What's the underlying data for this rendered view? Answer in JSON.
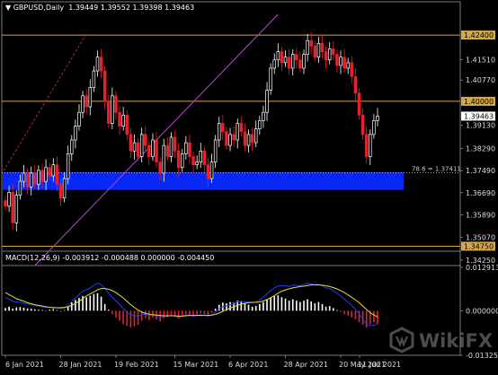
{
  "header": {
    "symbol": "GBPUSD,Daily",
    "open": "1.39449",
    "high": "1.39552",
    "low": "1.39398",
    "close": "1.39463"
  },
  "macd": {
    "label": "MACD(12,26,9)",
    "values": [
      "-0.003912",
      "-0.000488",
      "0.000000",
      "-0.004450"
    ],
    "axis_labels": [
      "0.012913",
      "0.000000",
      "-0.013251"
    ]
  },
  "price_axis": {
    "labels": [
      "1.41510",
      "1.40770",
      "1.39463",
      "1.39130",
      "1.38290",
      "1.37490",
      "1.36690",
      "1.35890",
      "1.35070",
      "1.34250"
    ],
    "highlighted": [
      "1.42400",
      "1.40000",
      "1.34750"
    ],
    "current": "1.39463"
  },
  "fib_label": "78.6 = 1.37411",
  "date_axis": [
    "6 Jan 2021",
    "28 Jan 2021",
    "19 Feb 2021",
    "15 Mar 2021",
    "6 Apr 2021",
    "28 Apr 2021",
    "20 May 2021",
    "11 Jun 2021"
  ],
  "watermark": "WikiFX",
  "colors": {
    "background": "#000000",
    "bull_candle": "#ffffff",
    "bear_candle": "#e8202a",
    "level_line": "#d4a84a",
    "zone": "#0a28f5",
    "trendline": "#b04cc8",
    "macd_hist_pos": "#ffffff",
    "macd_hist_neg": "#e8202a",
    "macd_line": "#1e3cff",
    "signal_line": "#e6dc3c"
  },
  "chart_data": {
    "type": "candlestick",
    "title": "GBPUSD,Daily",
    "ylim": [
      1.3405,
      1.4315
    ],
    "levels": [
      1.424,
      1.4,
      1.3475
    ],
    "zone": [
      1.3679,
      1.3743
    ],
    "fib_level": 1.37411,
    "close_series": [
      1.362,
      1.367,
      1.356,
      1.366,
      1.371,
      1.374,
      1.369,
      1.374,
      1.37,
      1.375,
      1.371,
      1.376,
      1.373,
      1.377,
      1.37,
      1.365,
      1.372,
      1.381,
      1.386,
      1.391,
      1.396,
      1.402,
      1.398,
      1.405,
      1.411,
      1.416,
      1.411,
      1.4,
      1.392,
      1.402,
      1.396,
      1.391,
      1.395,
      1.388,
      1.382,
      1.385,
      1.38,
      1.388,
      1.384,
      1.38,
      1.386,
      1.378,
      1.374,
      1.384,
      1.38,
      1.387,
      1.382,
      1.376,
      1.381,
      1.385,
      1.38,
      1.377,
      1.378,
      1.382,
      1.377,
      1.372,
      1.378,
      1.386,
      1.392,
      1.389,
      1.384,
      1.388,
      1.386,
      1.392,
      1.389,
      1.384,
      1.388,
      1.385,
      1.39,
      1.393,
      1.396,
      1.404,
      1.412,
      1.415,
      1.418,
      1.414,
      1.416,
      1.412,
      1.417,
      1.415,
      1.412,
      1.417,
      1.422,
      1.42,
      1.416,
      1.421,
      1.418,
      1.415,
      1.419,
      1.417,
      1.413,
      1.416,
      1.412,
      1.414,
      1.409,
      1.403,
      1.395,
      1.388,
      1.38,
      1.388,
      1.393,
      1.3946
    ],
    "macd_histogram": [
      0.0008,
      0.0012,
      0.0006,
      0.001,
      0.0011,
      0.0009,
      0.0007,
      0.0006,
      0.0004,
      0.0003,
      0.0002,
      0.0001,
      0.0003,
      0.0005,
      0.0002,
      -0.0004,
      0.0002,
      0.0012,
      0.0025,
      0.0032,
      0.0038,
      0.0044,
      0.004,
      0.0045,
      0.005,
      0.0052,
      0.0042,
      0.002,
      0.0003,
      -0.001,
      -0.002,
      -0.003,
      -0.004,
      -0.0045,
      -0.005,
      -0.0046,
      -0.0042,
      -0.003,
      -0.0022,
      -0.0028,
      -0.002,
      -0.0026,
      -0.0032,
      -0.0022,
      -0.002,
      -0.0016,
      -0.0018,
      -0.0024,
      -0.0016,
      -0.001,
      -0.0014,
      -0.0016,
      -0.0012,
      -0.0008,
      -0.001,
      -0.0014,
      -0.0006,
      0.0006,
      0.0018,
      0.0024,
      0.0022,
      0.0026,
      0.0024,
      0.003,
      0.0028,
      0.0022,
      0.0018,
      0.0012,
      0.0014,
      0.002,
      0.0026,
      0.0034,
      0.004,
      0.0044,
      0.0046,
      0.004,
      0.0036,
      0.003,
      0.0034,
      0.003,
      0.0026,
      0.003,
      0.0034,
      0.0028,
      0.0022,
      0.0026,
      0.002,
      0.0012,
      0.0014,
      0.0008,
      0.0002,
      -0.0004,
      -0.001,
      -0.0014,
      -0.002,
      -0.0026,
      -0.0034,
      -0.0042,
      -0.005,
      -0.004,
      -0.0034,
      -0.0039
    ],
    "macd_line": [
      0.004,
      0.0034,
      0.0028,
      0.0026,
      0.0025,
      0.0022,
      0.002,
      0.0018,
      0.0016,
      0.0014,
      0.0012,
      0.001,
      0.001,
      0.0011,
      0.0009,
      0.0006,
      0.0008,
      0.0016,
      0.0028,
      0.0038,
      0.0048,
      0.0058,
      0.0062,
      0.0068,
      0.0076,
      0.0082,
      0.0078,
      0.0066,
      0.0052,
      0.004,
      0.003,
      0.0018,
      0.0006,
      -0.0004,
      -0.0012,
      -0.0014,
      -0.0016,
      -0.0012,
      -0.001,
      -0.0014,
      -0.0012,
      -0.0016,
      -0.002,
      -0.0016,
      -0.0016,
      -0.0014,
      -0.0016,
      -0.002,
      -0.0016,
      -0.0012,
      -0.0014,
      -0.0016,
      -0.0014,
      -0.0012,
      -0.0013,
      -0.0016,
      -0.0012,
      -0.0004,
      0.0006,
      0.0012,
      0.0014,
      0.0018,
      0.002,
      0.0026,
      0.0028,
      0.0026,
      0.0026,
      0.0024,
      0.0026,
      0.0032,
      0.004,
      0.005,
      0.006,
      0.0068,
      0.0074,
      0.0074,
      0.0074,
      0.0072,
      0.0076,
      0.0076,
      0.0074,
      0.0078,
      0.0082,
      0.008,
      0.0076,
      0.0078,
      0.0074,
      0.0068,
      0.0066,
      0.006,
      0.0052,
      0.0044,
      0.0034,
      0.0026,
      0.0016,
      0.0004,
      -0.001,
      -0.0024,
      -0.004,
      -0.0044,
      -0.0044,
      -0.0039
    ],
    "signal_line": [
      0.0054,
      0.0048,
      0.0042,
      0.0036,
      0.0032,
      0.0028,
      0.0024,
      0.0021,
      0.0018,
      0.0016,
      0.0014,
      0.0012,
      0.001,
      0.0009,
      0.0009,
      0.0009,
      0.001,
      0.0012,
      0.0016,
      0.0022,
      0.0028,
      0.0036,
      0.0044,
      0.005,
      0.0056,
      0.0062,
      0.0066,
      0.0066,
      0.0064,
      0.006,
      0.0054,
      0.0046,
      0.0038,
      0.0028,
      0.0018,
      0.001,
      0.0002,
      -0.0004,
      -0.0008,
      -0.001,
      -0.0012,
      -0.0013,
      -0.0014,
      -0.0015,
      -0.0015,
      -0.0015,
      -0.0015,
      -0.0016,
      -0.0016,
      -0.0015,
      -0.0014,
      -0.0014,
      -0.0014,
      -0.0014,
      -0.0014,
      -0.0014,
      -0.0013,
      -0.0011,
      -0.0007,
      -0.0002,
      0.0003,
      0.0008,
      0.0012,
      0.0016,
      0.002,
      0.0022,
      0.0024,
      0.0025,
      0.0025,
      0.0026,
      0.0029,
      0.0033,
      0.0039,
      0.0045,
      0.0052,
      0.0058,
      0.0062,
      0.0065,
      0.0068,
      0.007,
      0.0072,
      0.0073,
      0.0075,
      0.0077,
      0.0077,
      0.0077,
      0.0076,
      0.0074,
      0.0072,
      0.0069,
      0.0065,
      0.006,
      0.0054,
      0.0047,
      0.004,
      0.0032,
      0.0024,
      0.0014,
      0.0004,
      -0.0006,
      -0.0012,
      -0.0019
    ],
    "macd_ylim": [
      -0.013251,
      0.012913
    ]
  }
}
